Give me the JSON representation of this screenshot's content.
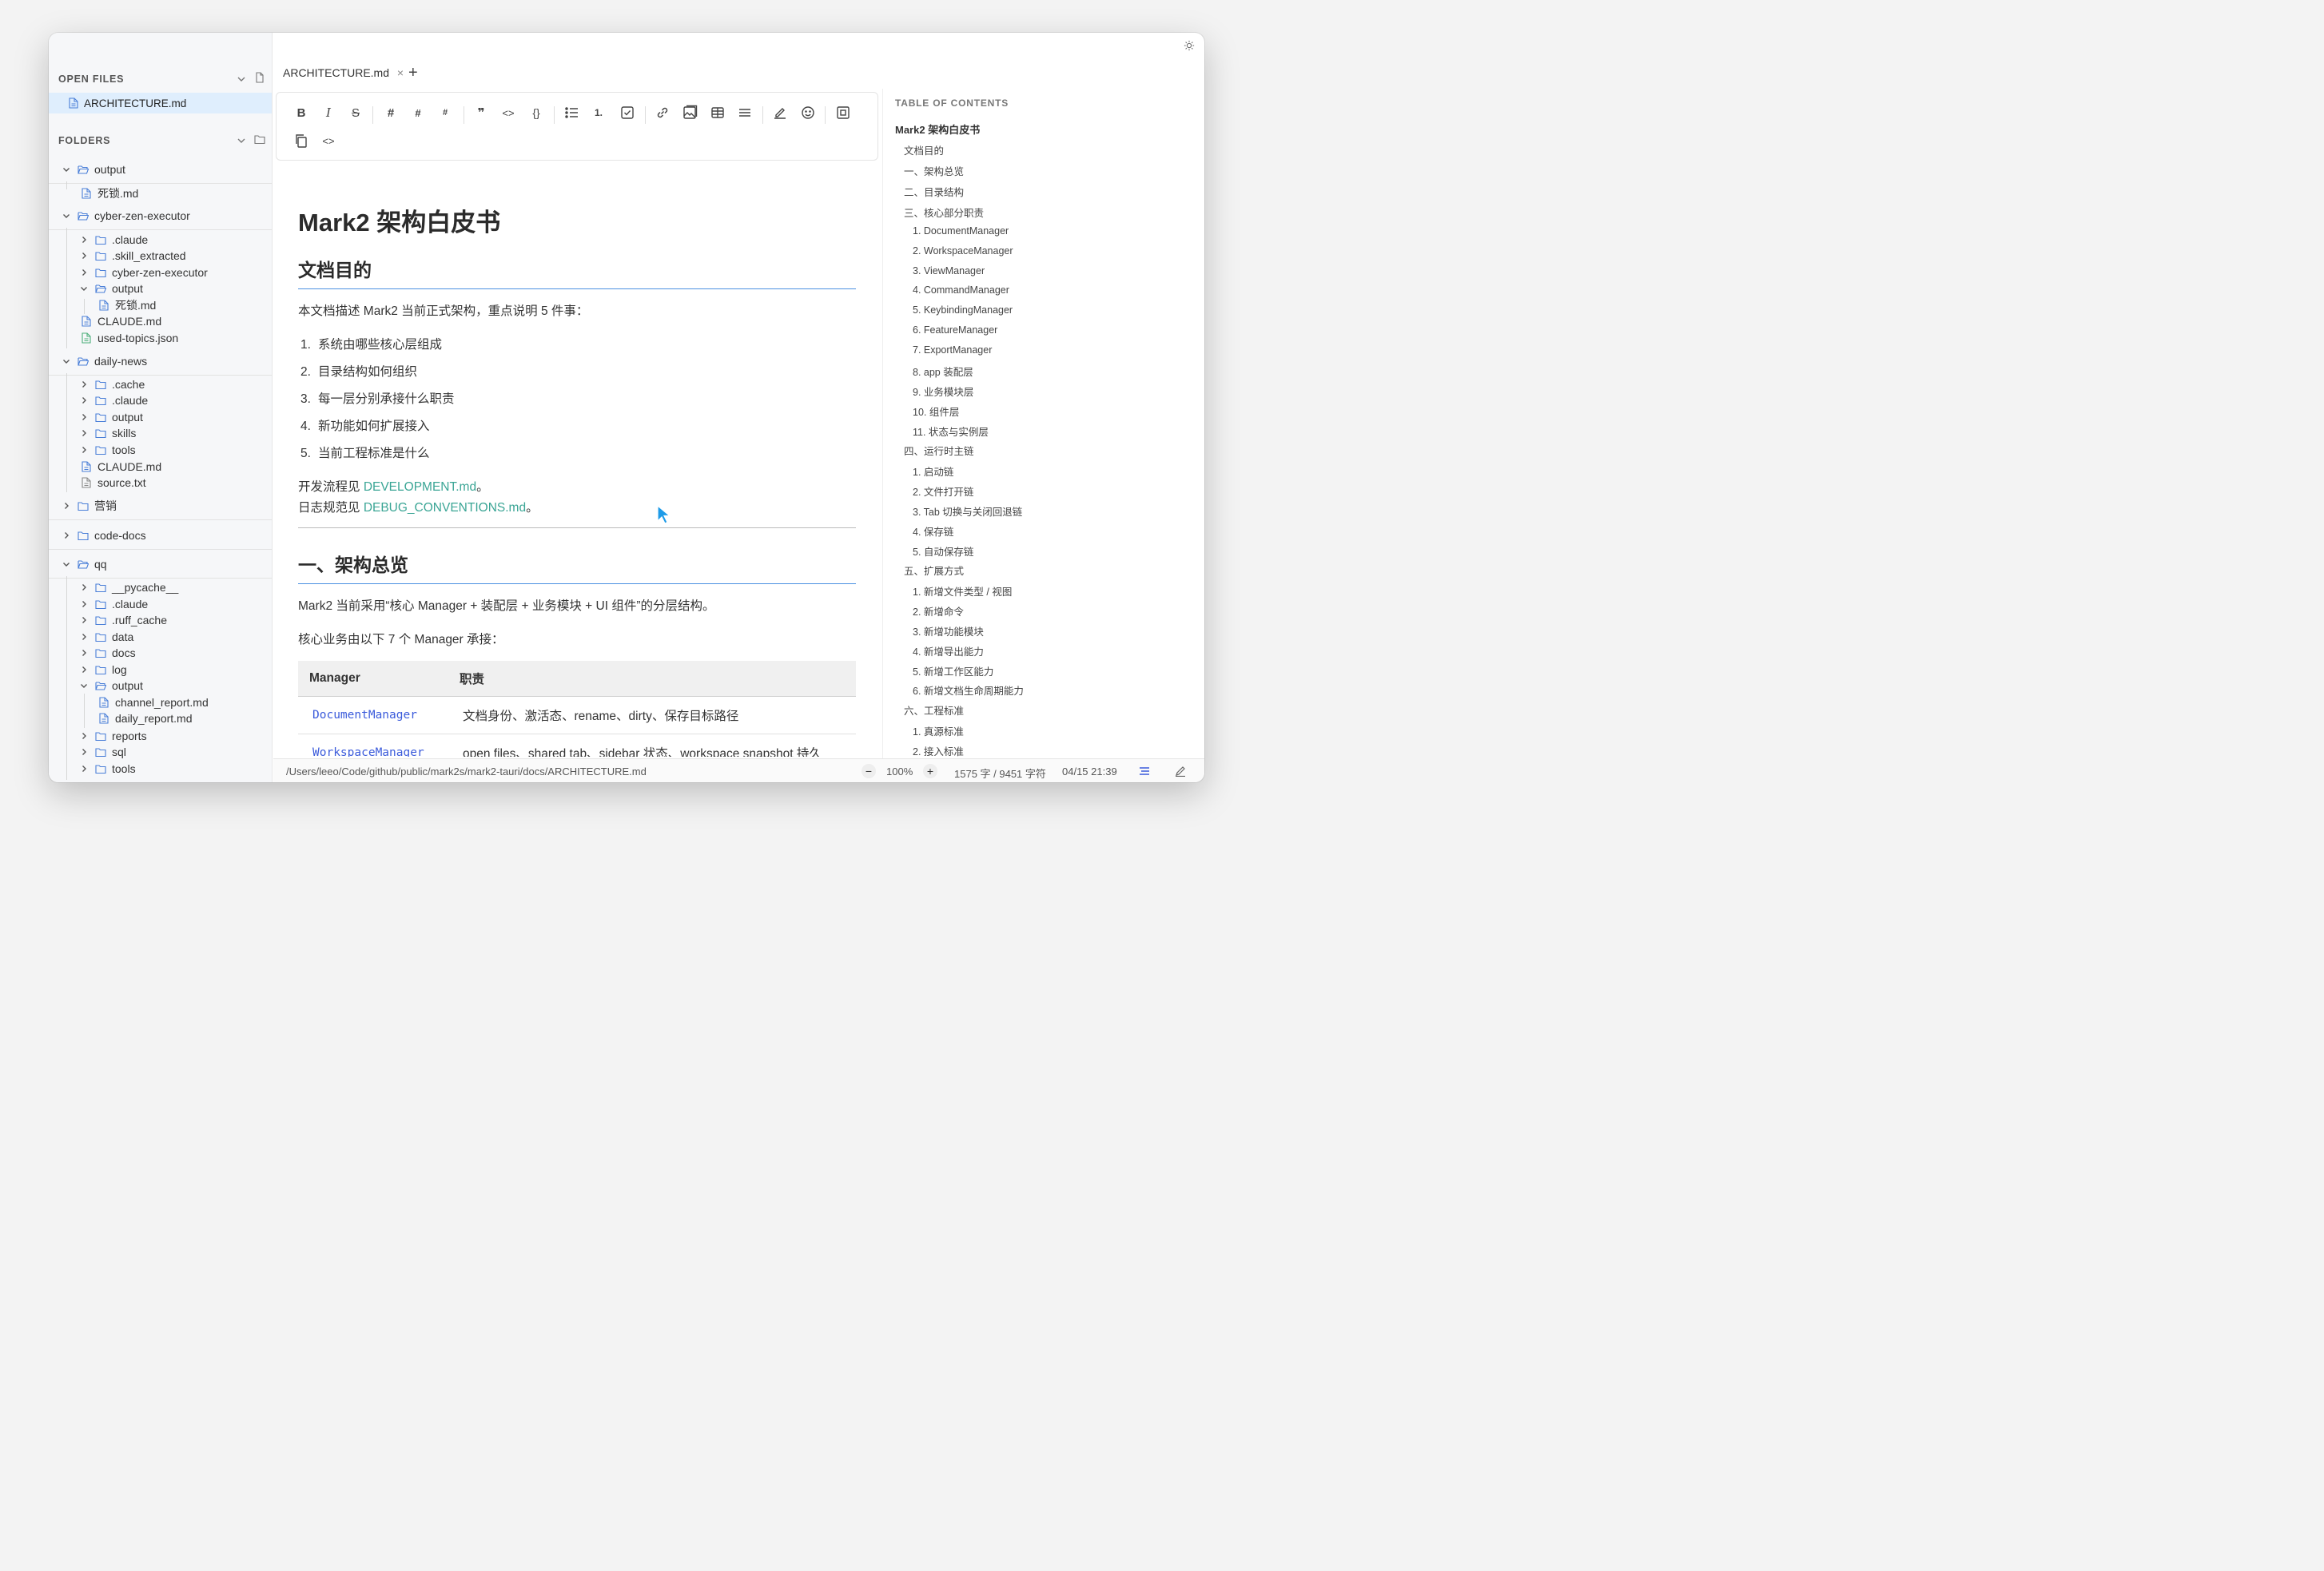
{
  "window": {
    "traffic_lights": [
      "#fe5f57",
      "#febc2e",
      "#28c840"
    ]
  },
  "sidebar": {
    "open_files_title": "OPEN FILES",
    "open_file": "ARCHITECTURE.md",
    "folders_title": "FOLDERS",
    "tree": [
      {
        "label": "output",
        "type": "folder",
        "expanded": true,
        "top": 0
      },
      {
        "label": "死锁.md",
        "type": "file"
      },
      {
        "label": "cyber-zen-executor",
        "type": "folder",
        "expanded": true
      },
      {
        "label": ".claude",
        "type": "folder"
      },
      {
        "label": ".skill_extracted",
        "type": "folder"
      },
      {
        "label": "cyber-zen-executor",
        "type": "folder"
      },
      {
        "label": "output",
        "type": "folder",
        "expanded": true
      },
      {
        "label": "死锁.md",
        "type": "file"
      },
      {
        "label": "CLAUDE.md",
        "type": "file"
      },
      {
        "label": "used-topics.json",
        "type": "file"
      },
      {
        "label": "daily-news",
        "type": "folder",
        "expanded": true
      },
      {
        "label": ".cache",
        "type": "folder"
      },
      {
        "label": ".claude",
        "type": "folder"
      },
      {
        "label": "output",
        "type": "folder"
      },
      {
        "label": "skills",
        "type": "folder"
      },
      {
        "label": "tools",
        "type": "folder"
      },
      {
        "label": "CLAUDE.md",
        "type": "file"
      },
      {
        "label": "source.txt",
        "type": "file"
      },
      {
        "label": "营销",
        "type": "folder"
      },
      {
        "label": "code-docs",
        "type": "folder"
      },
      {
        "label": "qq",
        "type": "folder",
        "expanded": true
      },
      {
        "label": "__pycache__",
        "type": "folder"
      },
      {
        "label": ".claude",
        "type": "folder"
      },
      {
        "label": ".ruff_cache",
        "type": "folder"
      },
      {
        "label": "data",
        "type": "folder"
      },
      {
        "label": "docs",
        "type": "folder"
      },
      {
        "label": "log",
        "type": "folder"
      },
      {
        "label": "output",
        "type": "folder",
        "expanded": true
      },
      {
        "label": "channel_report.md",
        "type": "file"
      },
      {
        "label": "daily_report.md",
        "type": "file"
      },
      {
        "label": "reports",
        "type": "folder"
      },
      {
        "label": "sql",
        "type": "folder"
      },
      {
        "label": "tools",
        "type": "folder"
      }
    ]
  },
  "tabs": {
    "active": "ARCHITECTURE.md",
    "close": "×",
    "add": "+"
  },
  "toolbar": {
    "bold": "B",
    "italic": "I",
    "strike": "S",
    "h1": "#",
    "h2": "#",
    "h3": "#",
    "quote": "❞",
    "code": "<>",
    "codeblock": "{}",
    "ol": "1.",
    "source": "<>"
  },
  "doc": {
    "title": "Mark2 架构白皮书",
    "h2_purpose": "文档目的",
    "intro": "本文档描述 Mark2 当前正式架构，重点说明 5 件事：",
    "list": [
      "系统由哪些核心层组成",
      "目录结构如何组织",
      "每一层分别承接什么职责",
      "新功能如何扩展接入",
      "当前工程标准是什么"
    ],
    "dev_prefix": "开发流程见 ",
    "dev_link": "DEVELOPMENT.md",
    "dev_suffix": "。",
    "log_prefix": "日志规范见 ",
    "log_link": "DEBUG_CONVENTIONS.md",
    "log_suffix": "。",
    "h2_overview": "一、架构总览",
    "overview_text": "Mark2 当前采用“核心 Manager + 装配层 + 业务模块 + UI 组件”的分层结构。",
    "managers_text": "核心业务由以下 7 个 Manager 承接：",
    "table_headers": [
      "Manager",
      "职责"
    ],
    "table_rows": [
      [
        "DocumentManager",
        "文档身份、激活态、rename、dirty、保存目标路径"
      ],
      [
        "WorkspaceManager",
        "open files、shared tab、sidebar 状态、workspace snapshot 持久"
      ]
    ]
  },
  "toc": {
    "title": "TABLE OF CONTENTS",
    "items": [
      {
        "text": "Mark2 架构白皮书",
        "level": 0
      },
      {
        "text": "文档目的",
        "level": 1
      },
      {
        "text": "一、架构总览",
        "level": 1
      },
      {
        "text": "二、目录结构",
        "level": 1
      },
      {
        "text": "三、核心部分职责",
        "level": 1
      },
      {
        "text": "1. DocumentManager",
        "level": 2
      },
      {
        "text": "2. WorkspaceManager",
        "level": 2
      },
      {
        "text": "3. ViewManager",
        "level": 2
      },
      {
        "text": "4. CommandManager",
        "level": 2
      },
      {
        "text": "5. KeybindingManager",
        "level": 2
      },
      {
        "text": "6. FeatureManager",
        "level": 2
      },
      {
        "text": "7. ExportManager",
        "level": 2
      },
      {
        "text": "8. app 装配层",
        "level": 2
      },
      {
        "text": "9. 业务模块层",
        "level": 2
      },
      {
        "text": "10. 组件层",
        "level": 2
      },
      {
        "text": "11. 状态与实例层",
        "level": 2
      },
      {
        "text": "四、运行时主链",
        "level": 1
      },
      {
        "text": "1. 启动链",
        "level": 2
      },
      {
        "text": "2. 文件打开链",
        "level": 2
      },
      {
        "text": "3. Tab 切换与关闭回退链",
        "level": 2
      },
      {
        "text": "4. 保存链",
        "level": 2
      },
      {
        "text": "5. 自动保存链",
        "level": 2
      },
      {
        "text": "五、扩展方式",
        "level": 1
      },
      {
        "text": "1. 新增文件类型 / 视图",
        "level": 2
      },
      {
        "text": "2. 新增命令",
        "level": 2
      },
      {
        "text": "3. 新增功能模块",
        "level": 2
      },
      {
        "text": "4. 新增导出能力",
        "level": 2
      },
      {
        "text": "5. 新增工作区能力",
        "level": 2
      },
      {
        "text": "6. 新增文档生命周期能力",
        "level": 2
      },
      {
        "text": "六、工程标准",
        "level": 1
      },
      {
        "text": "1. 真源标准",
        "level": 2
      },
      {
        "text": "2. 接入标准",
        "level": 2
      }
    ]
  },
  "status": {
    "path": "/Users/leeo/Code/github/public/mark2s/mark2-tauri/docs/ARCHITECTURE.md",
    "zoom_minus": "−",
    "zoom": "100%",
    "zoom_plus": "+",
    "counts": "1575 字 / 9451 字符",
    "datetime": "04/15 21:39"
  }
}
